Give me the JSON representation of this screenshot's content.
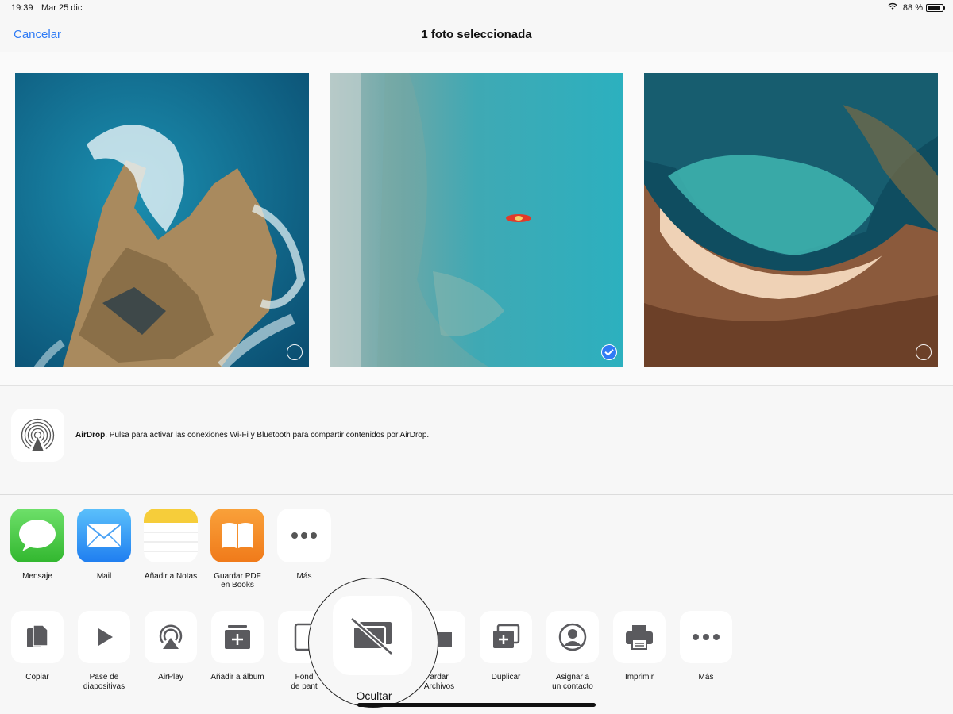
{
  "status_bar": {
    "time": "19:39",
    "date": "Mar 25 dic",
    "wifi_icon": "wifi-icon",
    "battery_percent": "88 %",
    "battery_level": 0.88
  },
  "nav": {
    "cancel_label": "Cancelar",
    "title": "1 foto seleccionada"
  },
  "photos": [
    {
      "name": "coastal-rocks-photo",
      "selected": false
    },
    {
      "name": "kayak-sea-photo",
      "selected": true
    },
    {
      "name": "beach-cove-photo",
      "selected": false
    }
  ],
  "airdrop": {
    "icon": "airdrop-icon",
    "title": "AirDrop",
    "description": ". Pulsa para activar las conexiones Wi-Fi y Bluetooth para compartir contenidos por AirDrop."
  },
  "apps": [
    {
      "label": "Mensaje",
      "icon": "messages-icon"
    },
    {
      "label": "Mail",
      "icon": "mail-icon"
    },
    {
      "label": "Añadir a Notas",
      "icon": "notes-icon"
    },
    {
      "label_line1": "Guardar PDF",
      "label_line2": "en Books",
      "icon": "books-icon"
    },
    {
      "label": "Más",
      "icon": "more-icon"
    }
  ],
  "actions": [
    {
      "label": "Copiar",
      "icon": "copy-icon"
    },
    {
      "label_line1": "Pase de",
      "label_line2": "diapositivas",
      "icon": "play-icon"
    },
    {
      "label": "AirPlay",
      "icon": "airplay-icon"
    },
    {
      "label": "Añadir a álbum",
      "icon": "add-album-icon"
    },
    {
      "label_line1": "Fond",
      "label_line2": "de pant",
      "icon": "wallpaper-icon"
    },
    {
      "label_line1": "ardar",
      "label_line2": "Archivos",
      "icon": "folder-icon"
    },
    {
      "label": "Duplicar",
      "icon": "duplicate-icon"
    },
    {
      "label_line1": "Asignar a",
      "label_line2": "un contacto",
      "icon": "contact-icon"
    },
    {
      "label": "Imprimir",
      "icon": "print-icon"
    },
    {
      "label": "Más",
      "icon": "more-icon"
    }
  ],
  "magnifier": {
    "label": "Ocultar",
    "icon": "hide-icon"
  },
  "colors": {
    "accent": "#2f7bf5",
    "icon_gray": "#5a5a5e"
  }
}
